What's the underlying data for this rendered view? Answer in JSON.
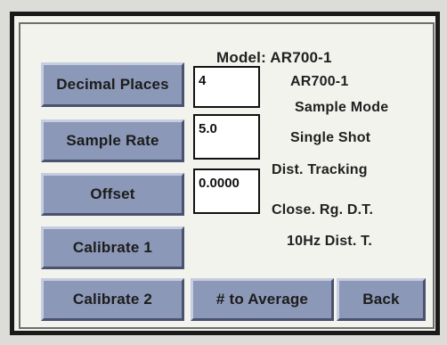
{
  "model_label": "Model:  AR700-1",
  "buttons": {
    "decimal_places": "Decimal Places",
    "sample_rate": "Sample Rate",
    "offset": "Offset",
    "calibrate_1": "Calibrate 1",
    "calibrate_2": "Calibrate 2",
    "to_average": "# to Average",
    "back": "Back"
  },
  "fields": {
    "decimal_places_value": "4",
    "sample_rate_value": "5.0",
    "offset_value": "0.0000"
  },
  "info": {
    "model_value": "AR700-1",
    "sample_mode_label": "Sample Mode",
    "sample_mode_value": "Single Shot",
    "dist_tracking": "Dist. Tracking",
    "close_rg": "Close. Rg. D.T.",
    "hz_dist": "10Hz Dist. T."
  },
  "colors": {
    "button_face": "#8c98b7",
    "screen_bg": "#f3f3ee",
    "frame": "#1a1a1a"
  }
}
